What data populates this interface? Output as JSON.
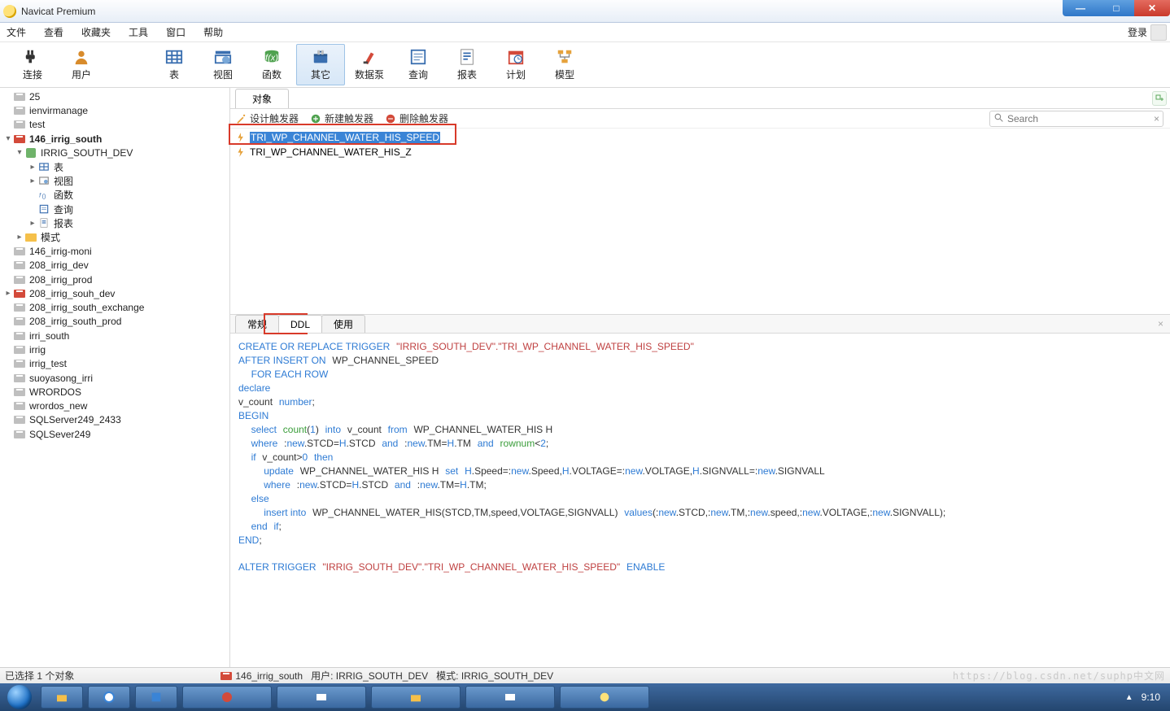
{
  "window": {
    "title": "Navicat Premium"
  },
  "menu": {
    "items": [
      "文件",
      "查看",
      "收藏夹",
      "工具",
      "窗口",
      "帮助"
    ],
    "login": "登录"
  },
  "toolbar": {
    "items": [
      {
        "label": "连接",
        "icon": "plug"
      },
      {
        "label": "用户",
        "icon": "user"
      },
      {
        "label": "表",
        "icon": "table"
      },
      {
        "label": "视图",
        "icon": "view"
      },
      {
        "label": "函数",
        "icon": "fn"
      },
      {
        "label": "其它",
        "icon": "other",
        "active": true
      },
      {
        "label": "数据泵",
        "icon": "pump"
      },
      {
        "label": "查询",
        "icon": "query"
      },
      {
        "label": "报表",
        "icon": "report"
      },
      {
        "label": "计划",
        "icon": "plan"
      },
      {
        "label": "模型",
        "icon": "model"
      }
    ]
  },
  "tree": [
    {
      "ind": 1,
      "arrow": "none",
      "icon": "db-grey",
      "label": "25"
    },
    {
      "ind": 1,
      "arrow": "none",
      "icon": "db-grey",
      "label": "ienvirmanage"
    },
    {
      "ind": 1,
      "arrow": "none",
      "icon": "db-grey",
      "label": "test"
    },
    {
      "ind": 1,
      "arrow": "open",
      "icon": "db-red",
      "label": "146_irrig_south",
      "bold": true
    },
    {
      "ind": 2,
      "arrow": "open",
      "icon": "schema",
      "label": "IRRIG_SOUTH_DEV"
    },
    {
      "ind": 3,
      "arrow": "closed",
      "icon": "table",
      "label": "表"
    },
    {
      "ind": 3,
      "arrow": "closed",
      "icon": "view",
      "label": "视图"
    },
    {
      "ind": 3,
      "arrow": "none",
      "icon": "fn",
      "label": "函数"
    },
    {
      "ind": 3,
      "arrow": "none",
      "icon": "query",
      "label": "查询"
    },
    {
      "ind": 3,
      "arrow": "closed",
      "icon": "report",
      "label": "报表"
    },
    {
      "ind": 2,
      "arrow": "closed",
      "icon": "folder",
      "label": "模式"
    },
    {
      "ind": 1,
      "arrow": "none",
      "icon": "db-grey",
      "label": "146_irrig-moni"
    },
    {
      "ind": 1,
      "arrow": "none",
      "icon": "db-grey",
      "label": "208_irrig_dev"
    },
    {
      "ind": 1,
      "arrow": "none",
      "icon": "db-grey",
      "label": "208_irrig_prod"
    },
    {
      "ind": 1,
      "arrow": "closed",
      "icon": "db-red",
      "label": "208_irrig_souh_dev"
    },
    {
      "ind": 1,
      "arrow": "none",
      "icon": "db-grey",
      "label": "208_irrig_south_exchange"
    },
    {
      "ind": 1,
      "arrow": "none",
      "icon": "db-grey",
      "label": "208_irrig_south_prod"
    },
    {
      "ind": 1,
      "arrow": "none",
      "icon": "db-grey",
      "label": "irri_south"
    },
    {
      "ind": 1,
      "arrow": "none",
      "icon": "db-grey",
      "label": "irrig"
    },
    {
      "ind": 1,
      "arrow": "none",
      "icon": "db-grey",
      "label": "irrig_test"
    },
    {
      "ind": 1,
      "arrow": "none",
      "icon": "db-grey",
      "label": "suoyasong_irri"
    },
    {
      "ind": 1,
      "arrow": "none",
      "icon": "db-grey",
      "label": "WRORDOS"
    },
    {
      "ind": 1,
      "arrow": "none",
      "icon": "db-grey",
      "label": "wrordos_new"
    },
    {
      "ind": 1,
      "arrow": "none",
      "icon": "db-grey",
      "label": "SQLServer249_2433"
    },
    {
      "ind": 1,
      "arrow": "none",
      "icon": "db-grey",
      "label": "SQLSever249"
    }
  ],
  "object_tab": "对象",
  "actions": {
    "design": "设计触发器",
    "new": "新建触发器",
    "delete": "删除触发器"
  },
  "search_placeholder": "Search",
  "triggers": [
    {
      "name": "TRI_WP_CHANNEL_WATER_HIS_SPEED",
      "selected": true
    },
    {
      "name": "TRI_WP_CHANNEL_WATER_HIS_Z",
      "selected": false
    }
  ],
  "detail_tabs": {
    "t1": "常规",
    "t2": "DDL",
    "t3": "使用",
    "active": "DDL"
  },
  "sql": {
    "l1a": "CREATE OR REPLACE TRIGGER",
    "l1b": "\"IRRIG_SOUTH_DEV\".\"TRI_WP_CHANNEL_WATER_HIS_SPEED\"",
    "l2a": "AFTER INSERT ON",
    "l2b": "WP_CHANNEL_SPEED",
    "l3": "FOR EACH ROW",
    "l4": "declare",
    "l5a": "v_count",
    "l5b": "number",
    "l5c": ";",
    "l6": "BEGIN",
    "l7a": "select",
    "l7b": "count",
    "l7c": "(",
    "l7d": "1",
    "l7e": ")",
    "l7f": "into",
    "l7g": "v_count",
    "l7h": "from",
    "l7i": "WP_CHANNEL_WATER_HIS H",
    "l8a": "where",
    "l8b": ":",
    "l8c": "new",
    "l8d": ".STCD=",
    "l8e": "H",
    "l8f": ".STCD",
    "l8g": "and",
    "l8h": ":",
    "l8i": "new",
    "l8j": ".TM=",
    "l8k": "H",
    "l8l": ".TM",
    "l8m": "and",
    "l8n": "rownum",
    "l8o": "<",
    "l8p": "2",
    "l8q": ";",
    "l9a": "if",
    "l9b": "v_count>",
    "l9c": "0",
    "l9d": "then",
    "l10a": "update",
    "l10b": "WP_CHANNEL_WATER_HIS H",
    "l10c": "set",
    "l10d": "H",
    "l10e": ".Speed=:",
    "l10f": "new",
    "l10g": ".Speed,",
    "l10h": "H",
    "l10i": ".VOLTAGE=:",
    "l10j": "new",
    "l10k": ".VOLTAGE,",
    "l10l": "H",
    "l10m": ".SIGNVALL=:",
    "l10n": "new",
    "l10o": ".SIGNVALL",
    "l11a": "where",
    "l11b": ":",
    "l11c": "new",
    "l11d": ".STCD=",
    "l11e": "H",
    "l11f": ".STCD",
    "l11g": "and",
    "l11h": ":",
    "l11i": "new",
    "l11j": ".TM=",
    "l11k": "H",
    "l11l": ".TM;",
    "l12": "else",
    "l13a": "insert into",
    "l13b": "WP_CHANNEL_WATER_HIS(STCD,TM,speed,VOLTAGE,SIGNVALL)",
    "l13c": "values",
    "l13d": "(:",
    "l13e": "new",
    "l13f": ".STCD,:",
    "l13g": "new",
    "l13h": ".TM,:",
    "l13i": "new",
    "l13j": ".speed,:",
    "l13k": "new",
    "l13l": ".VOLTAGE,:",
    "l13m": "new",
    "l13n": ".SIGNVALL);",
    "l14a": "end",
    "l14b": "if",
    "l14c": ";",
    "l15a": "END",
    "l15b": ";",
    "l17a": "ALTER TRIGGER",
    "l17b": "\"IRRIG_SOUTH_DEV\".\"TRI_WP_CHANNEL_WATER_HIS_SPEED\"",
    "l17c": "ENABLE"
  },
  "status": {
    "selection": "已选择 1 个对象",
    "db": "146_irrig_south",
    "user_label": "用户:",
    "user": "IRRIG_SOUTH_DEV",
    "mode_label": "模式:",
    "mode": "IRRIG_SOUTH_DEV",
    "watermark": "https://blog.csdn.net/suphp中文网"
  },
  "taskbar": {
    "time": "9:10"
  }
}
